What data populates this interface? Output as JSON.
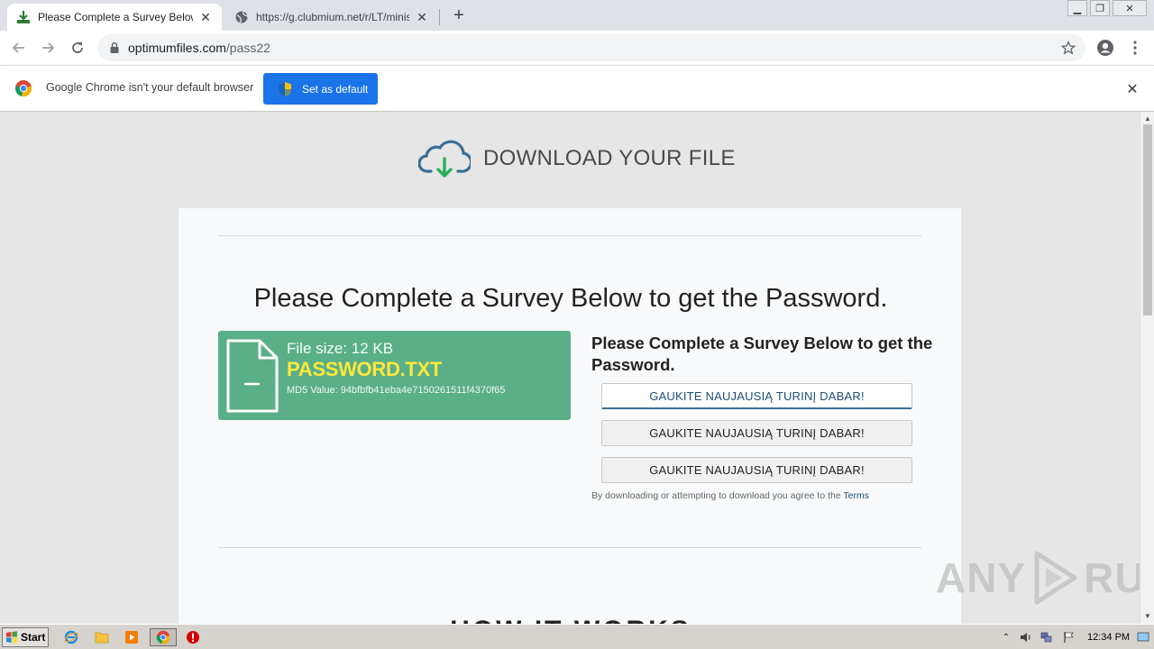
{
  "browser": {
    "tabs": [
      {
        "title": "Please Complete a Survey Below to get the Password",
        "active": true,
        "icon": "download-icon"
      },
      {
        "title": "https://g.clubmium.net/r/LT/minisite",
        "active": false,
        "icon": "globe-icon"
      }
    ],
    "address": {
      "domain": "optimumfiles.com",
      "path": "/pass22"
    },
    "infobar": {
      "message": "Google Chrome isn't your default browser",
      "button_label": "Set as default"
    }
  },
  "page": {
    "header_title": "DOWNLOAD YOUR FILE",
    "card_title": "Please Complete a Survey Below to get the Password.",
    "file": {
      "size_label": "File size: 12 KB",
      "name": "PASSWORD.TXT",
      "md5_label": "MD5 Value: 94bfbfb41eba4e7150261511f4370f65"
    },
    "side_title": "Please Complete a Survey Below to get the Password.",
    "survey_buttons": [
      "GAUKITE NAUJAUSIĄ TURINĮ DABAR!",
      "GAUKITE NAUJAUSIĄ TURINĮ DABAR!",
      "GAUKITE NAUJAUSIĄ TURINĮ DABAR!"
    ],
    "terms_prefix": "By downloading or attempting to download you agree to the",
    "terms_link": "Terms",
    "how_it_works": "HOW IT WORKS"
  },
  "watermark": {
    "left": "ANY",
    "right": "RUN"
  },
  "taskbar": {
    "start_label": "Start",
    "clock": "12:34 PM"
  },
  "colors": {
    "accent_blue": "#1a73e8",
    "file_green": "#5aaf88",
    "filename_yellow": "#ffe83a",
    "cloud_blue": "#3a6e96",
    "arrow_green": "#27ae60"
  }
}
